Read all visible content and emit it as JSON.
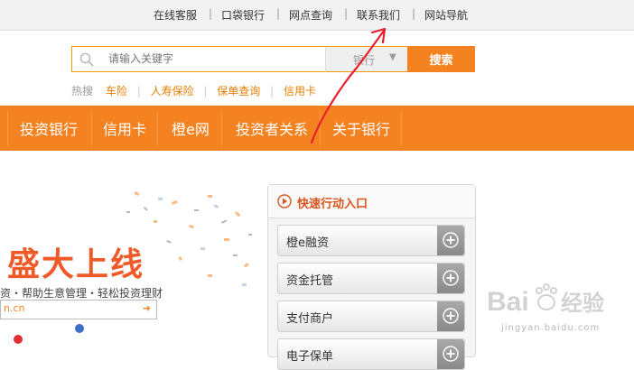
{
  "topbar": {
    "links": [
      "在线客服",
      "口袋银行",
      "网点查询",
      "联系我们",
      "网站导航"
    ],
    "separator": "|"
  },
  "search": {
    "placeholder": "请输入关键字",
    "select_value": "银行",
    "button_label": "搜索"
  },
  "hot": {
    "label": "热搜",
    "links": [
      "车险",
      "人寿保险",
      "保单查询",
      "信用卡"
    ],
    "separator": "|"
  },
  "nav": {
    "items": [
      "投资银行",
      "信用卡",
      "橙e网",
      "投资者关系",
      "关于银行"
    ]
  },
  "banner": {
    "title": "盛大上线",
    "subtitle": "资・帮助生意管理・轻松投资理财",
    "url_fragment": "n.cn"
  },
  "panel": {
    "title": "快速行动入口",
    "items": [
      "橙e融资",
      "资金托管",
      "支付商户",
      "电子保单"
    ]
  },
  "watermark": {
    "text": "Bai 经验",
    "url": "jingyan.baidu.com"
  },
  "colors": {
    "accent": "#f58220",
    "annotation": "#e8202a"
  }
}
